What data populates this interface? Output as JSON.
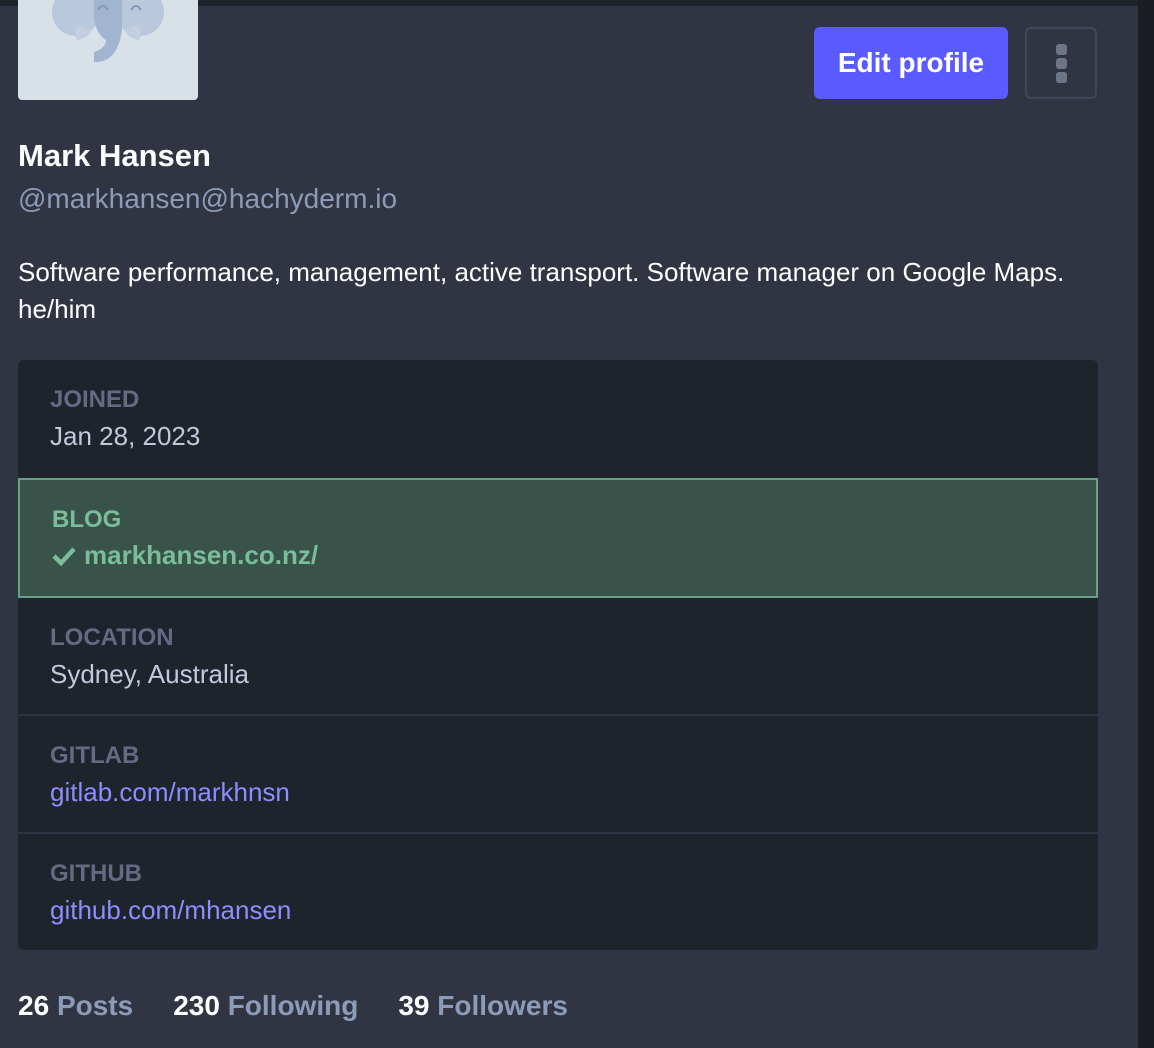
{
  "profile": {
    "display_name": "Mark Hansen",
    "handle": "@markhansen@hachyderm.io",
    "bio": "Software performance, management, active transport. Software manager on Google Maps. he/him"
  },
  "actions": {
    "edit_profile_label": "Edit profile",
    "more_icon": "vertical-ellipsis-icon"
  },
  "fields": [
    {
      "label": "JOINED",
      "value": "Jan 28, 2023",
      "verified": false,
      "link": false
    },
    {
      "label": "BLOG",
      "value": "markhansen.co.nz/",
      "verified": true,
      "link": true
    },
    {
      "label": "LOCATION",
      "value": "Sydney, Australia",
      "verified": false,
      "link": false
    },
    {
      "label": "GITLAB",
      "value": "gitlab.com/markhnsn",
      "verified": false,
      "link": true
    },
    {
      "label": "GITHUB",
      "value": "github.com/mhansen",
      "verified": false,
      "link": true
    }
  ],
  "stats": [
    {
      "count": "26",
      "label": "Posts"
    },
    {
      "count": "230",
      "label": "Following"
    },
    {
      "count": "39",
      "label": "Followers"
    }
  ],
  "colors": {
    "accent": "#595aff",
    "verified": "#79bd9a",
    "link": "#8c8dff",
    "background": "#313543",
    "panel": "#1f232b"
  }
}
